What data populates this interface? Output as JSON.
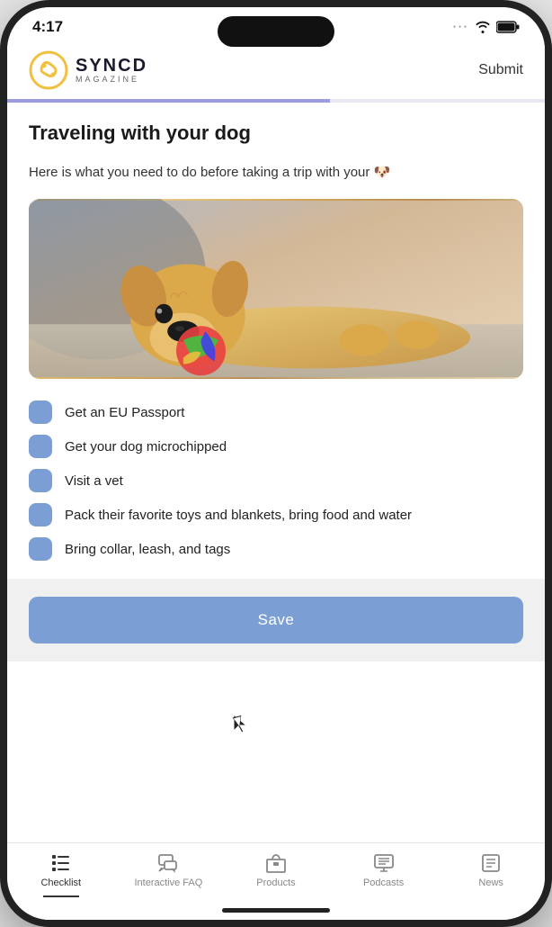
{
  "statusBar": {
    "time": "4:17",
    "wifiLabel": "wifi",
    "batteryLabel": "battery"
  },
  "header": {
    "logoTitle": "SYNCD",
    "logoSubtitle": "MAGAZINE",
    "submitLabel": "Submit"
  },
  "article": {
    "title": "Traveling with your dog",
    "intro": "Here is what you need to do before taking a trip with your 🐶"
  },
  "checklist": {
    "items": [
      {
        "text": "Get an EU Passport",
        "checked": false
      },
      {
        "text": "Get your dog microchipped",
        "checked": false
      },
      {
        "text": "Visit a vet",
        "checked": false
      },
      {
        "text": "Pack their favorite toys and blankets, bring food and water",
        "checked": false
      },
      {
        "text": "Bring collar, leash, and tags",
        "checked": false
      }
    ]
  },
  "saveButton": {
    "label": "Save"
  },
  "tabBar": {
    "items": [
      {
        "id": "checklist",
        "label": "Checklist",
        "icon": "checklist",
        "active": true
      },
      {
        "id": "faq",
        "label": "Interactive FAQ",
        "icon": "faq",
        "active": false
      },
      {
        "id": "products",
        "label": "Products",
        "icon": "products",
        "active": false
      },
      {
        "id": "podcasts",
        "label": "Podcasts",
        "icon": "podcasts",
        "active": false
      },
      {
        "id": "news",
        "label": "News",
        "icon": "news",
        "active": false
      }
    ]
  }
}
